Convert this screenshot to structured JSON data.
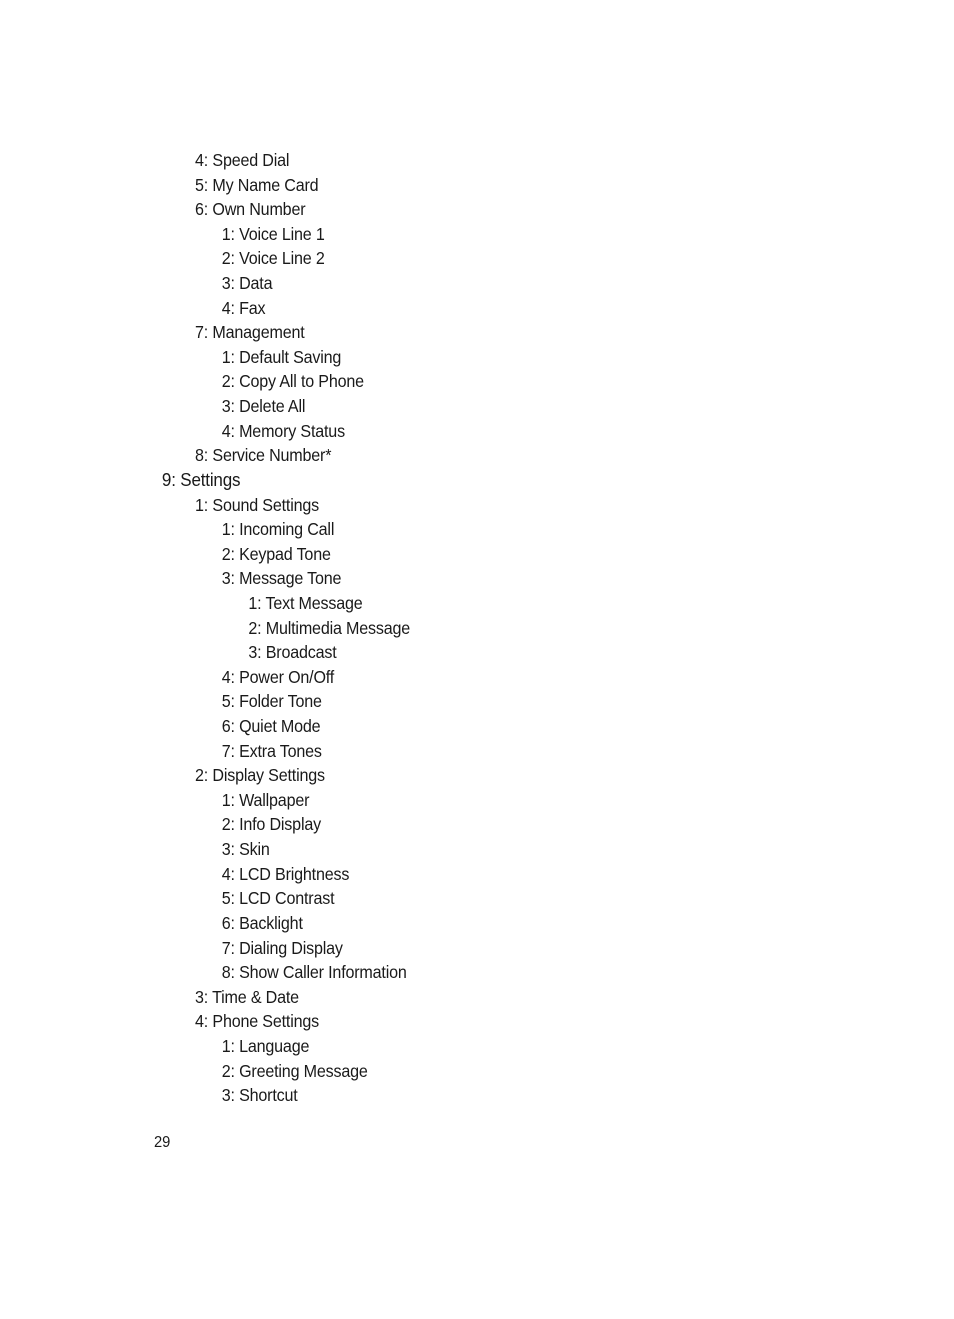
{
  "menu_items": [
    {
      "level": 1,
      "label": "4: Speed Dial"
    },
    {
      "level": 1,
      "label": "5: My Name Card"
    },
    {
      "level": 1,
      "label": "6: Own Number"
    },
    {
      "level": 2,
      "label": "1: Voice Line 1"
    },
    {
      "level": 2,
      "label": "2: Voice Line 2"
    },
    {
      "level": 2,
      "label": "3: Data"
    },
    {
      "level": 2,
      "label": "4: Fax"
    },
    {
      "level": 1,
      "label": "7: Management"
    },
    {
      "level": 2,
      "label": "1: Default Saving"
    },
    {
      "level": 2,
      "label": "2: Copy All to Phone"
    },
    {
      "level": 2,
      "label": "3: Delete All"
    },
    {
      "level": 2,
      "label": "4: Memory Status"
    },
    {
      "level": 1,
      "label": "8: Service Number*"
    },
    {
      "level": 0,
      "label": "9: Settings"
    },
    {
      "level": 1,
      "label": "1: Sound Settings"
    },
    {
      "level": 2,
      "label": "1: Incoming Call"
    },
    {
      "level": 2,
      "label": "2: Keypad Tone"
    },
    {
      "level": 2,
      "label": "3: Message Tone"
    },
    {
      "level": 3,
      "label": "1: Text Message"
    },
    {
      "level": 3,
      "label": "2: Multimedia Message"
    },
    {
      "level": 3,
      "label": "3: Broadcast"
    },
    {
      "level": 2,
      "label": "4: Power On/Off"
    },
    {
      "level": 2,
      "label": "5: Folder Tone"
    },
    {
      "level": 2,
      "label": "6: Quiet Mode"
    },
    {
      "level": 2,
      "label": "7: Extra Tones"
    },
    {
      "level": 1,
      "label": "2: Display Settings"
    },
    {
      "level": 2,
      "label": "1: Wallpaper"
    },
    {
      "level": 2,
      "label": "2: Info Display"
    },
    {
      "level": 2,
      "label": "3: Skin"
    },
    {
      "level": 2,
      "label": "4: LCD Brightness"
    },
    {
      "level": 2,
      "label": "5: LCD Contrast"
    },
    {
      "level": 2,
      "label": "6: Backlight"
    },
    {
      "level": 2,
      "label": "7: Dialing Display"
    },
    {
      "level": 2,
      "label": "8: Show Caller Information"
    },
    {
      "level": 1,
      "label": "3: Time & Date"
    },
    {
      "level": 1,
      "label": "4: Phone Settings"
    },
    {
      "level": 2,
      "label": "1: Language"
    },
    {
      "level": 2,
      "label": "2: Greeting Message"
    },
    {
      "level": 2,
      "label": "3: Shortcut"
    }
  ],
  "page_number": "29"
}
